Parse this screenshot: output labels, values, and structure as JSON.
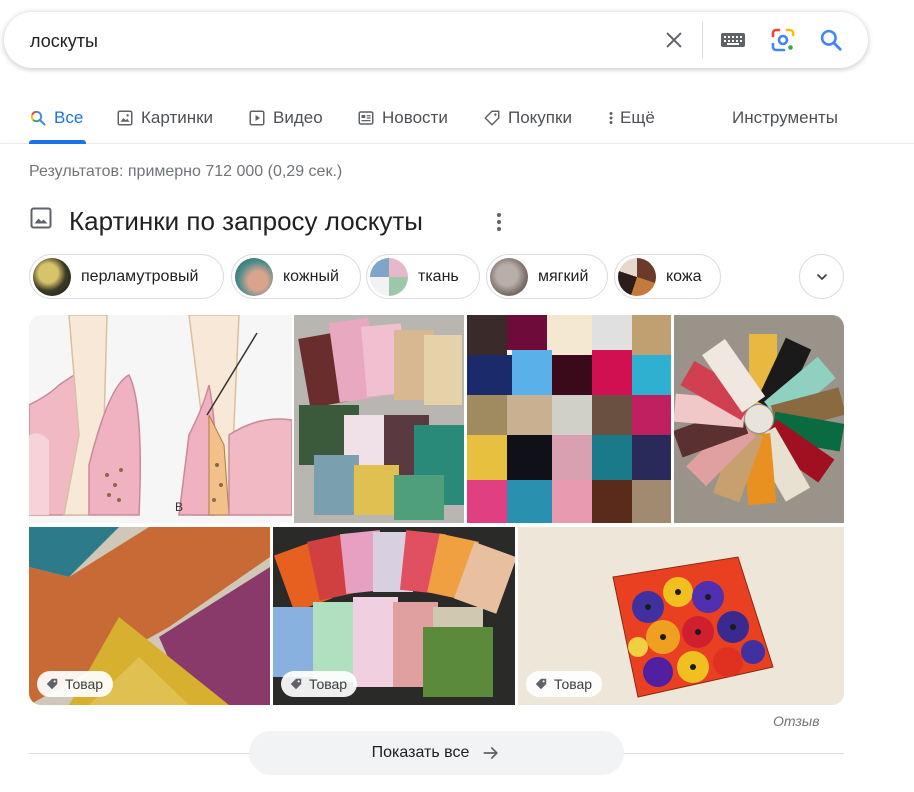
{
  "search": {
    "query": "лоскуты",
    "icons": [
      "close-icon",
      "keyboard-icon",
      "lens-icon",
      "search-icon"
    ]
  },
  "tabs": [
    {
      "label": "Все",
      "icon": "search-icon",
      "active": true
    },
    {
      "label": "Картинки",
      "icon": "image-icon"
    },
    {
      "label": "Видео",
      "icon": "play-icon"
    },
    {
      "label": "Новости",
      "icon": "news-icon"
    },
    {
      "label": "Покупки",
      "icon": "tag-icon"
    },
    {
      "label": "Ещё",
      "icon": "more-vert-icon"
    }
  ],
  "tools_label": "Инструменты",
  "results_count": "Результатов: примерно 712 000 (0,29 сек.)",
  "images_section": {
    "title": "Картинки по запросу лоскуты",
    "chips": [
      {
        "label": "перламутровый"
      },
      {
        "label": "кожный"
      },
      {
        "label": "ткань"
      },
      {
        "label": "мягкий"
      },
      {
        "label": "кожа"
      }
    ],
    "product_badge": "Товар",
    "diagram_letter": "B"
  },
  "feedback_label": "Отзыв",
  "show_all_label": "Показать все",
  "colors": {
    "accent": "#1a73e8",
    "text": "#202124",
    "muted": "#70757a",
    "border": "#dadce0"
  }
}
